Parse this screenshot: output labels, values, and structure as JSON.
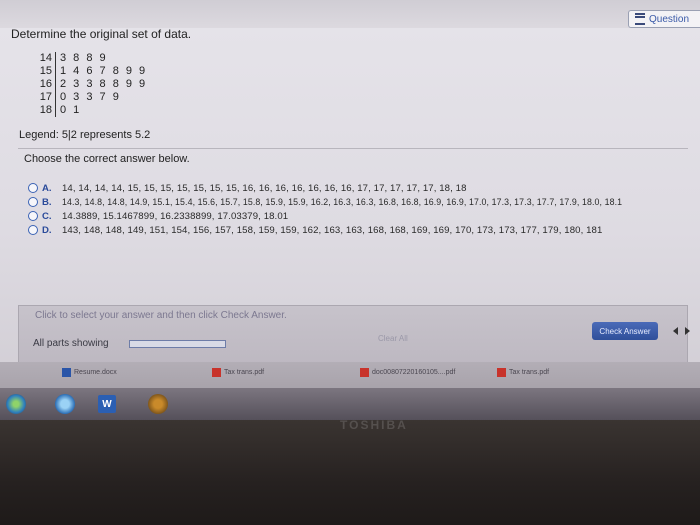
{
  "header": {
    "question_label": "Question"
  },
  "problem": {
    "title": "Determine the original set of data.",
    "stem_leaf": [
      {
        "stem": "14",
        "leaves": "3 8 8 9"
      },
      {
        "stem": "15",
        "leaves": "1 4 6 7 8 9 9"
      },
      {
        "stem": "16",
        "leaves": "2 3 3 8 8 9 9"
      },
      {
        "stem": "17",
        "leaves": "0 3 3 7 9"
      },
      {
        "stem": "18",
        "leaves": "0 1"
      }
    ],
    "legend": "Legend: 5|2 represents 5.2",
    "instruction": "Choose the correct answer below."
  },
  "options": [
    {
      "letter": "A.",
      "text": "14, 14, 14, 14, 15, 15, 15, 15, 15, 15, 15, 16, 16, 16, 16, 16, 16, 16, 17, 17, 17, 17, 17, 18, 18"
    },
    {
      "letter": "B.",
      "text": "14.3, 14.8, 14.8, 14.9, 15.1, 15.4, 15.6, 15.7, 15.8, 15.9, 15.9, 16.2, 16.3, 16.3, 16.8, 16.8, 16.9, 16.9, 17.0, 17.3, 17.3, 17.7, 17.9, 18.0, 18.1"
    },
    {
      "letter": "C.",
      "text": "14.3889, 15.1467899, 16.2338899, 17.03379, 18.01"
    },
    {
      "letter": "D.",
      "text": "143, 148, 148, 149, 151, 154, 156, 157, 158, 159, 159, 162, 163, 163, 168, 168, 169, 169, 170, 173, 173, 177, 179, 180, 181"
    }
  ],
  "footer": {
    "hint": "Click to select your answer and then click Check Answer.",
    "parts": "All parts showing",
    "clear": "Clear All",
    "check": "Check Answer"
  },
  "downloads": [
    {
      "name": "Resume.docx",
      "type": "doc"
    },
    {
      "name": "Tax trans.pdf",
      "type": "pdf"
    },
    {
      "name": "doc00807220160105....pdf",
      "type": "pdf"
    },
    {
      "name": "Tax trans.pdf",
      "type": "pdf"
    }
  ],
  "taskbar": {
    "word_letter": "W"
  },
  "brand": "TOSHIBA"
}
